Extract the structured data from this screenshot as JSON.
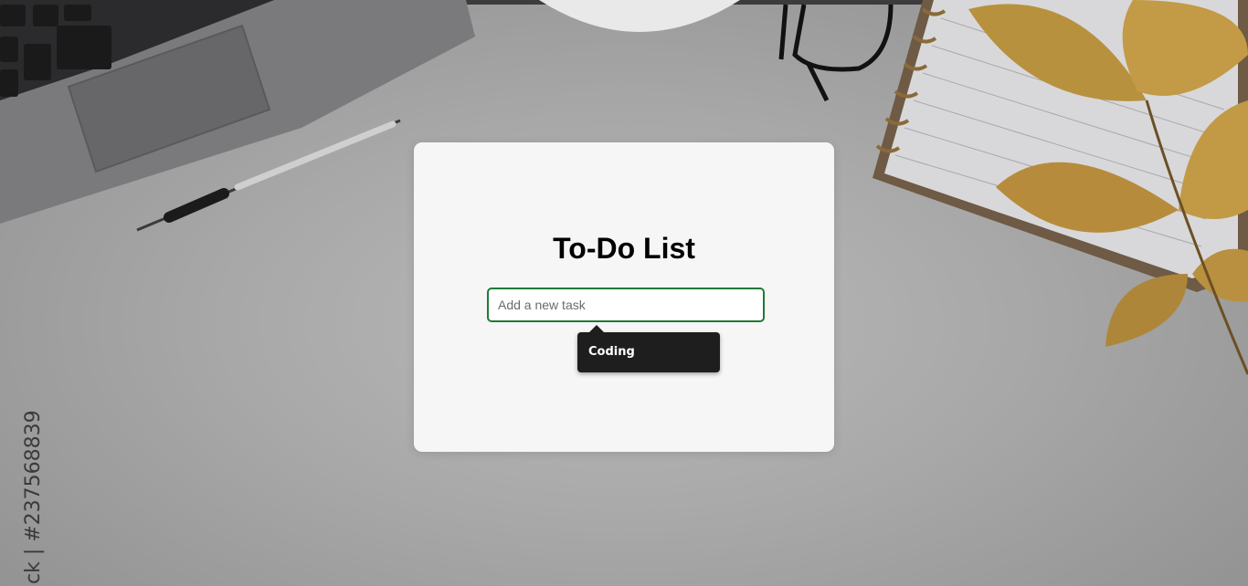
{
  "app": {
    "title": "To-Do List"
  },
  "task_input": {
    "value": "",
    "placeholder": "Add a new task"
  },
  "autocomplete": {
    "suggestion": "Coding"
  },
  "background": {
    "watermark_id": "ck | #237568839",
    "description_icons": [
      "laptop-icon",
      "pen-icon",
      "glasses-icon",
      "notebook-icon",
      "leaves-icon",
      "cup-icon"
    ]
  },
  "colors": {
    "input_border": "#1f7a34",
    "card_background": "#f6f6f6",
    "tooltip_background": "#1e1e1e"
  }
}
